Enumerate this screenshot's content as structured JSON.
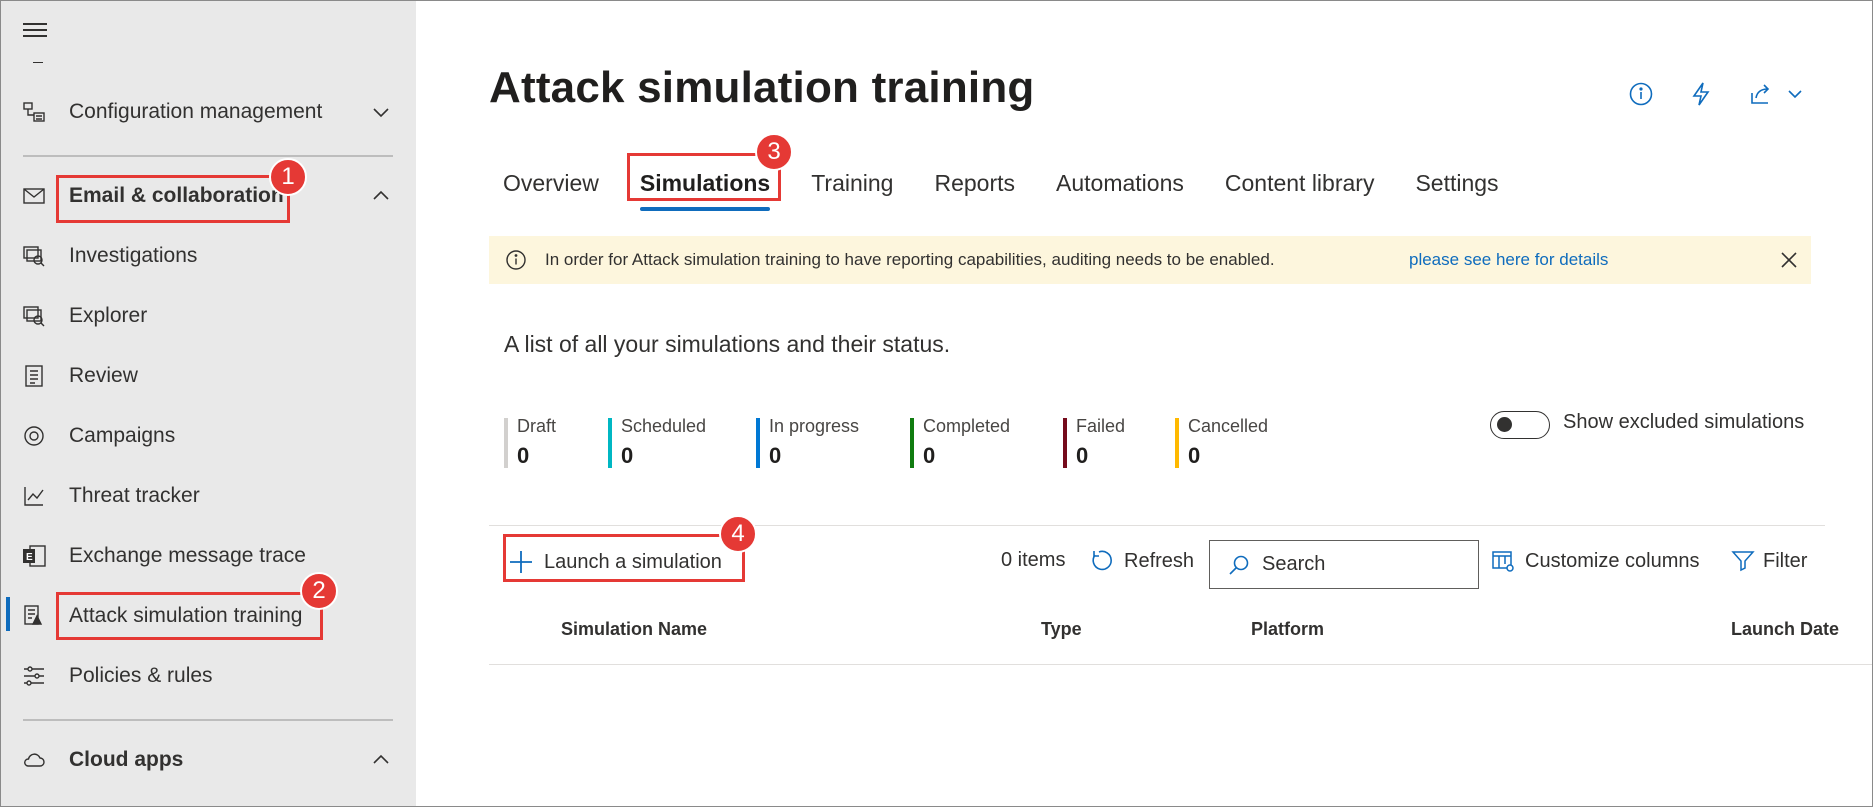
{
  "sidebar": {
    "items": [
      {
        "label": "Configuration management",
        "icon": "configuration-icon"
      },
      {
        "label": "Email & collaboration",
        "icon": "mail-icon"
      },
      {
        "label": "Investigations",
        "icon": "investigations-icon"
      },
      {
        "label": "Explorer",
        "icon": "explorer-icon"
      },
      {
        "label": "Review",
        "icon": "review-icon"
      },
      {
        "label": "Campaigns",
        "icon": "campaigns-icon"
      },
      {
        "label": "Threat tracker",
        "icon": "threat-tracker-icon"
      },
      {
        "label": "Exchange message trace",
        "icon": "exchange-icon"
      },
      {
        "label": "Attack simulation training",
        "icon": "attack-simulation-icon"
      },
      {
        "label": "Policies & rules",
        "icon": "policies-icon"
      },
      {
        "label": "Cloud apps",
        "icon": "cloud-icon"
      }
    ]
  },
  "page": {
    "title": "Attack simulation training",
    "header_icons": [
      "info-icon",
      "lightning-icon",
      "share-icon",
      "chevron-down-icon"
    ]
  },
  "tabs": [
    {
      "label": "Overview"
    },
    {
      "label": "Simulations",
      "active": true
    },
    {
      "label": "Training"
    },
    {
      "label": "Reports"
    },
    {
      "label": "Automations"
    },
    {
      "label": "Content library"
    },
    {
      "label": "Settings"
    }
  ],
  "banner": {
    "message": "In order for Attack simulation training to have reporting capabilities, auditing needs to be enabled.",
    "link": "please see here for details"
  },
  "subtitle": "A list of all your simulations and their status.",
  "stats": [
    {
      "label": "Draft",
      "value": "0",
      "color": "#d2d0ce"
    },
    {
      "label": "Scheduled",
      "value": "0",
      "color": "#00b7c3"
    },
    {
      "label": "In progress",
      "value": "0",
      "color": "#0078d4"
    },
    {
      "label": "Completed",
      "value": "0",
      "color": "#107c10"
    },
    {
      "label": "Failed",
      "value": "0",
      "color": "#750b1c"
    },
    {
      "label": "Cancelled",
      "value": "0",
      "color": "#ffb900"
    }
  ],
  "toggle": {
    "label": "Show excluded simulations",
    "on": false
  },
  "toolbar": {
    "launch_label": "Launch a simulation",
    "items_count": "0 items",
    "refresh_label": "Refresh",
    "search_placeholder": "Search",
    "customize_label": "Customize columns",
    "filter_label": "Filter"
  },
  "table": {
    "columns": [
      "Simulation Name",
      "Type",
      "Platform",
      "Launch Date"
    ]
  },
  "callouts": [
    "1",
    "2",
    "3",
    "4"
  ],
  "colors": {
    "accent": "#0f6cbd",
    "callout": "#e53935",
    "banner": "#fdf6dd",
    "sidebar": "#e9e9e9"
  }
}
